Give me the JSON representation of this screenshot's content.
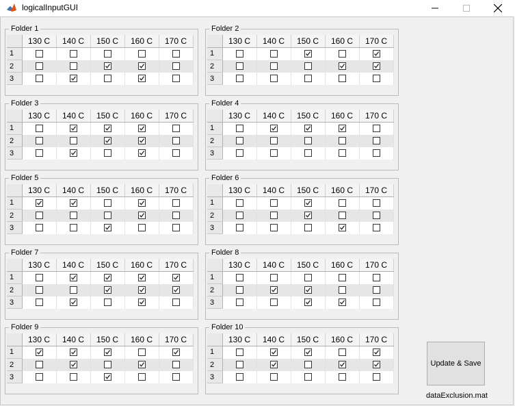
{
  "window": {
    "title": "logicalInputGUI"
  },
  "columns": [
    "130 C",
    "140 C",
    "150 C",
    "160 C",
    "170 C"
  ],
  "rows": [
    "1",
    "2",
    "3"
  ],
  "folders": [
    {
      "title": "Folder 1",
      "checks": [
        [
          0,
          0,
          0,
          0,
          0
        ],
        [
          0,
          0,
          1,
          1,
          0
        ],
        [
          0,
          1,
          0,
          1,
          0
        ]
      ]
    },
    {
      "title": "Folder 2",
      "checks": [
        [
          0,
          0,
          1,
          0,
          1
        ],
        [
          0,
          0,
          0,
          1,
          1
        ],
        [
          0,
          0,
          0,
          0,
          0
        ]
      ]
    },
    {
      "title": "Folder 3",
      "checks": [
        [
          0,
          1,
          1,
          1,
          0
        ],
        [
          0,
          0,
          1,
          1,
          0
        ],
        [
          0,
          1,
          0,
          1,
          0
        ]
      ]
    },
    {
      "title": "Folder 4",
      "checks": [
        [
          0,
          1,
          1,
          1,
          0
        ],
        [
          0,
          0,
          0,
          0,
          0
        ],
        [
          0,
          0,
          0,
          0,
          0
        ]
      ]
    },
    {
      "title": "Folder 5",
      "checks": [
        [
          1,
          1,
          0,
          1,
          0
        ],
        [
          0,
          0,
          0,
          1,
          0
        ],
        [
          0,
          0,
          1,
          0,
          0
        ]
      ]
    },
    {
      "title": "Folder 6",
      "checks": [
        [
          0,
          0,
          1,
          0,
          0
        ],
        [
          0,
          0,
          1,
          0,
          0
        ],
        [
          0,
          0,
          0,
          1,
          0
        ]
      ]
    },
    {
      "title": "Folder 7",
      "checks": [
        [
          0,
          1,
          1,
          1,
          1
        ],
        [
          0,
          0,
          1,
          1,
          1
        ],
        [
          0,
          1,
          0,
          1,
          0
        ]
      ]
    },
    {
      "title": "Folder 8",
      "checks": [
        [
          0,
          0,
          0,
          0,
          0
        ],
        [
          0,
          1,
          1,
          0,
          0
        ],
        [
          0,
          0,
          1,
          1,
          0
        ]
      ]
    },
    {
      "title": "Folder 9",
      "checks": [
        [
          1,
          1,
          1,
          0,
          1
        ],
        [
          0,
          1,
          0,
          1,
          0
        ],
        [
          0,
          0,
          1,
          0,
          0
        ]
      ]
    },
    {
      "title": "Folder 10",
      "checks": [
        [
          0,
          1,
          1,
          0,
          1
        ],
        [
          0,
          1,
          0,
          1,
          1
        ],
        [
          0,
          0,
          0,
          0,
          0
        ]
      ]
    }
  ],
  "update_button": {
    "label": "Update & Save"
  },
  "file_label": "dataExclusion.mat"
}
